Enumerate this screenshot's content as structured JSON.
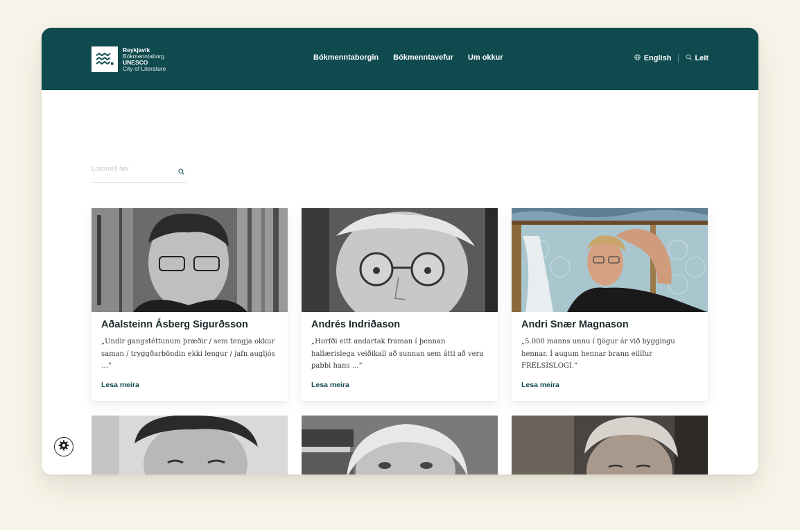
{
  "header": {
    "logo": {
      "line1": "Reykjavík",
      "line2": "Bókmenntaborg",
      "line3": "UNESCO",
      "line4": "City of Literature"
    },
    "nav": [
      {
        "label": "Bókmenntaborgin"
      },
      {
        "label": "Bókmenntavefur"
      },
      {
        "label": "Um okkur"
      }
    ],
    "language": "English",
    "search_label": "Leit",
    "icons": {
      "language": "globe-icon",
      "search": "search-icon"
    }
  },
  "search": {
    "placeholder": "Leitarorð hér",
    "icon": "search-icon"
  },
  "cards": [
    {
      "name": "Aðalsteinn Ásberg Sigurðsson",
      "quote": "„Undir gangstéttunum þræðir / sem tengja okkur saman / tryggðarböndin ekki lengur / jafn augljós …\"",
      "link": "Lesa meira"
    },
    {
      "name": "Andrés Indriðason",
      "quote": "„Horfði eitt andartak framan í þennan hallærislega veiðikall að sunnan sem átti að vera pabbi hans …\"",
      "link": "Lesa meira"
    },
    {
      "name": "Andri Snær Magnason",
      "quote": "„5.000 manns unnu í fjögur ár við byggingu hennar. Í augum hennar brann eilífur FRELSISLOGI.\"",
      "link": "Lesa meira"
    }
  ],
  "colors": {
    "brand": "#0f4a4f",
    "page_bg": "#f7f4e9"
  },
  "cookie_icon": "gear-icon"
}
